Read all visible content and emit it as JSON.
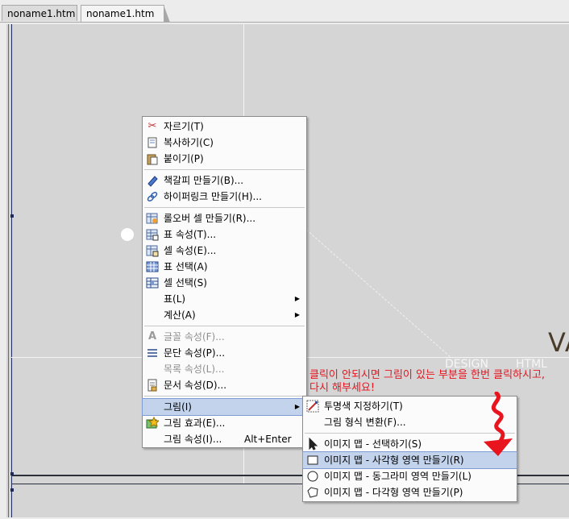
{
  "tabs": [
    {
      "label": "noname1.htm"
    },
    {
      "label": "noname1.htm"
    }
  ],
  "canvas": {
    "big_letters": "VA",
    "watermark_left": "DESIGN",
    "watermark_right": "HTML"
  },
  "context_menu": {
    "items": [
      {
        "label": "자르기(T)",
        "icon": "scissors-icon"
      },
      {
        "label": "복사하기(C)",
        "icon": "copy-icon"
      },
      {
        "label": "붙이기(P)",
        "icon": "paste-icon"
      },
      {
        "label": "책갈피 만들기(B)...",
        "icon": "bookmark-icon"
      },
      {
        "label": "하이퍼링크 만들기(H)...",
        "icon": "hyperlink-icon"
      },
      {
        "label": "롤오버 셀 만들기(R)...",
        "icon": "rollover-cell-icon"
      },
      {
        "label": "표 속성(T)...",
        "icon": "table-props-icon"
      },
      {
        "label": "셀 속성(E)...",
        "icon": "cell-props-icon"
      },
      {
        "label": "표 선택(A)",
        "icon": "table-select-icon"
      },
      {
        "label": "셀 선택(S)",
        "icon": "cell-select-icon"
      },
      {
        "label": "표(L)",
        "has_submenu": true
      },
      {
        "label": "계산(A)",
        "has_submenu": true
      },
      {
        "label": "글꼴 속성(F)...",
        "icon": "font-icon",
        "disabled": true
      },
      {
        "label": "문단 속성(P)...",
        "icon": "paragraph-icon"
      },
      {
        "label": "목록 속성(L)...",
        "disabled": true
      },
      {
        "label": "문서 속성(D)...",
        "icon": "document-icon"
      },
      {
        "label": "그림(I)",
        "has_submenu": true,
        "active": true
      },
      {
        "label": "그림 효과(E)...",
        "icon": "image-effect-icon"
      },
      {
        "label": "그림 속성(I)...",
        "shortcut": "Alt+Enter"
      }
    ]
  },
  "image_submenu": {
    "items": [
      {
        "label": "투명색 지정하기(T)",
        "icon": "transparency-icon"
      },
      {
        "label": "그림 형식 변환(F)..."
      },
      {
        "label": "이미지 맵 - 선택하기(S)",
        "icon": "pointer-icon"
      },
      {
        "label": "이미지 맵 - 사각형 영역 만들기(R)",
        "icon": "rectangle-icon",
        "active": true
      },
      {
        "label": "이미지 맵 - 동그라미 영역 만들기(L)",
        "icon": "circle-icon"
      },
      {
        "label": "이미지 맵 - 다각형 영역 만들기(P)",
        "icon": "polygon-icon"
      }
    ]
  },
  "annotation": {
    "line1": "클릭이 안되시면 그림이 있는 부분을 한번 클릭하시고,",
    "line2": "다시 해부세요!"
  },
  "colors": {
    "annotation": "#e8141e",
    "menu_highlight": "#c3d3ec",
    "canvas": "#d5d5d5"
  }
}
